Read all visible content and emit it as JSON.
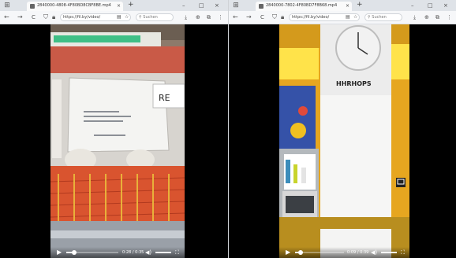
{
  "left": {
    "tab_title": "2840000-4808-4F80BD8CBF8BE.mp4",
    "new_tab": "+",
    "url": "https://fil.by/video/",
    "search_placeholder": "Suchen",
    "time": "0:28 / 0:35"
  },
  "right": {
    "tab_title": "2840000-7802-4F80BD7F8B68.mp4",
    "new_tab": "+",
    "url": "https://fil.by/video/",
    "search_placeholder": "Suchen",
    "time": "0:09 / 0:39",
    "clock_label": "HHRHOPS"
  },
  "paper_label": "RE",
  "icons": {
    "minimize": "–",
    "maximize": "□",
    "close": "×",
    "back": "←",
    "forward": "→",
    "reload": "C",
    "play": "▶",
    "volume": "🔊",
    "fullscreen": "⛶"
  },
  "progress": {
    "left_played_fraction": 0.15,
    "right_played_fraction": 0.12,
    "left_volume_fraction": 1.0,
    "right_volume_fraction": 1.0
  }
}
